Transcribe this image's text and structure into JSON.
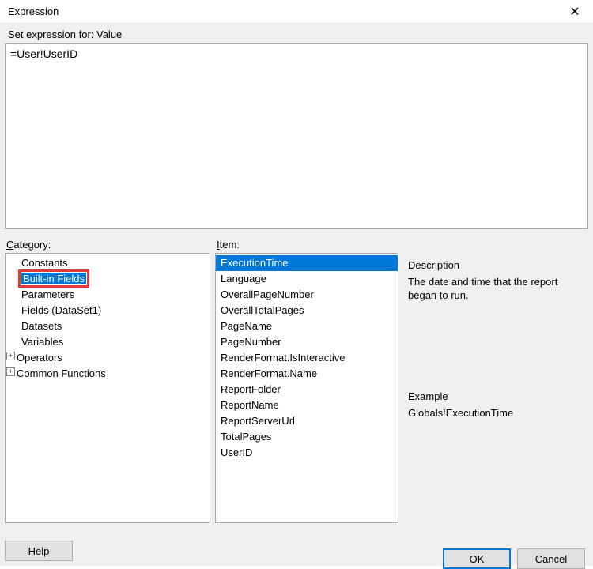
{
  "window": {
    "title": "Expression",
    "close_glyph": "✕"
  },
  "set_expression_label": "Set expression for: Value",
  "expression_value": "=User!UserID",
  "category_label_prefix": "C",
  "category_label_rest": "ategory:",
  "item_label_prefix": "I",
  "item_label_rest": "tem:",
  "categories": [
    {
      "label": "Constants",
      "expandable": false,
      "indent": 1
    },
    {
      "label": "Built-in Fields",
      "expandable": false,
      "indent": 1,
      "selected": true,
      "highlight": true
    },
    {
      "label": "Parameters",
      "expandable": false,
      "indent": 1
    },
    {
      "label": "Fields (DataSet1)",
      "expandable": false,
      "indent": 1
    },
    {
      "label": "Datasets",
      "expandable": false,
      "indent": 1
    },
    {
      "label": "Variables",
      "expandable": false,
      "indent": 1
    },
    {
      "label": "Operators",
      "expandable": true,
      "indent": 0
    },
    {
      "label": "Common Functions",
      "expandable": true,
      "indent": 0
    }
  ],
  "items": [
    {
      "label": "ExecutionTime",
      "selected": true
    },
    {
      "label": "Language"
    },
    {
      "label": "OverallPageNumber"
    },
    {
      "label": "OverallTotalPages"
    },
    {
      "label": "PageName"
    },
    {
      "label": "PageNumber"
    },
    {
      "label": "RenderFormat.IsInteractive"
    },
    {
      "label": "RenderFormat.Name"
    },
    {
      "label": "ReportFolder"
    },
    {
      "label": "ReportName"
    },
    {
      "label": "ReportServerUrl"
    },
    {
      "label": "TotalPages"
    },
    {
      "label": "UserID"
    }
  ],
  "description": {
    "title": "Description",
    "body": "The date and time that the report began to run."
  },
  "example": {
    "title": "Example",
    "body": "Globals!ExecutionTime"
  },
  "buttons": {
    "help": "Help",
    "ok": "OK",
    "cancel": "Cancel"
  }
}
